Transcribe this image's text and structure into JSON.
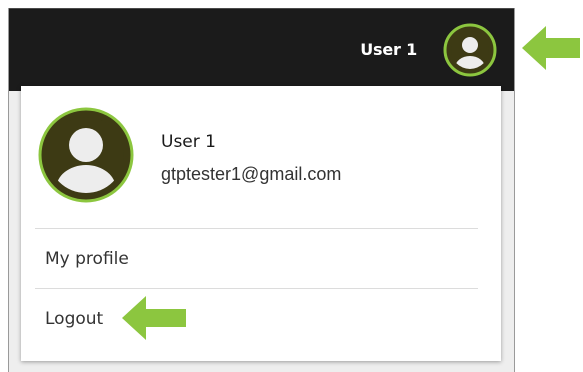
{
  "topbar": {
    "username": "User 1",
    "avatar_icon": "user-avatar-icon"
  },
  "profile": {
    "name": "User 1",
    "email": "gtptester1@gmail.com",
    "avatar_icon": "user-avatar-icon"
  },
  "menu": {
    "items": [
      {
        "label": "My profile"
      },
      {
        "label": "Logout"
      }
    ]
  },
  "annotations": {
    "arrow_color": "#8cc63f",
    "arrow_icon": "arrow-left-icon"
  },
  "colors": {
    "topbar_bg": "#1b1b1b",
    "avatar_ring": "#8cc63f",
    "avatar_bg": "#3a3a1a"
  }
}
